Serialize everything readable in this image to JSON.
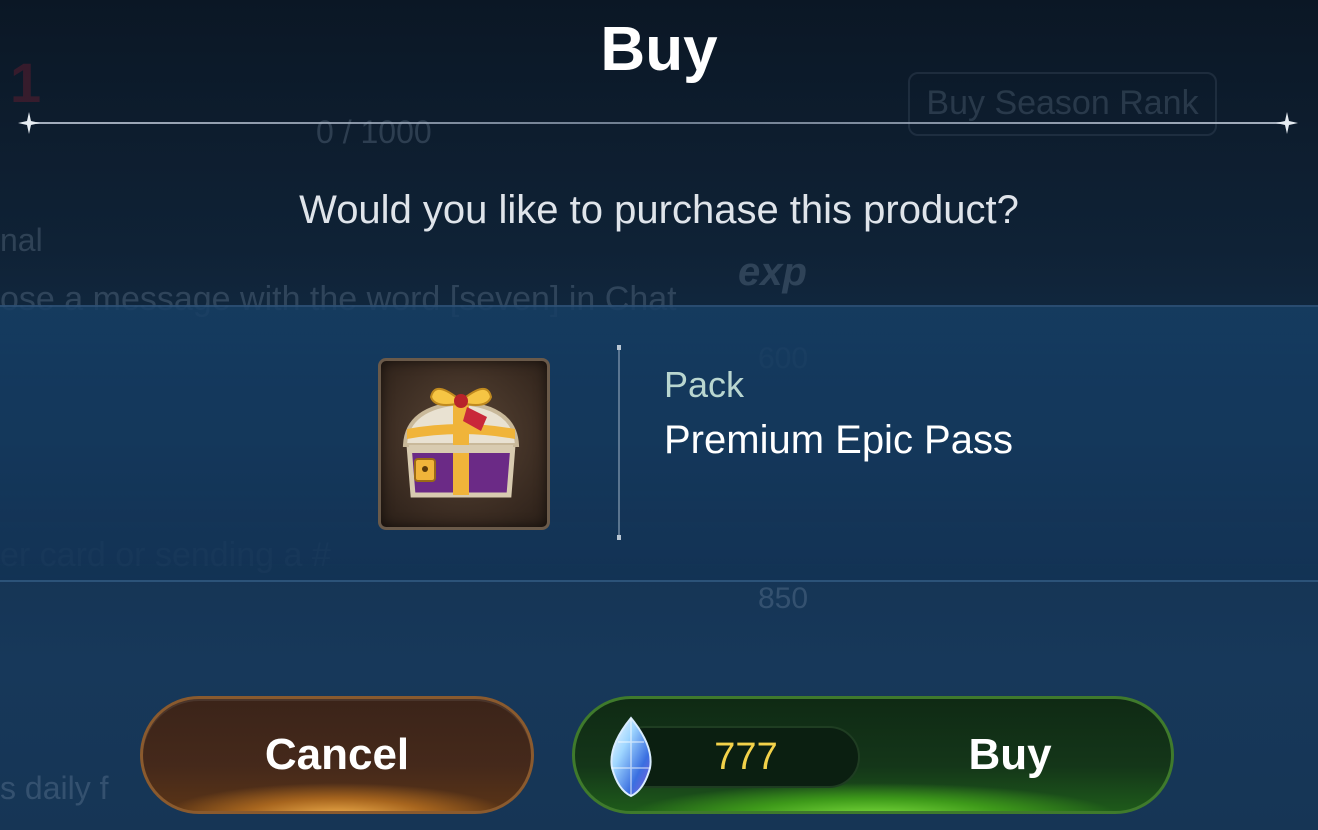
{
  "background": {
    "rank_button": "Buy Season Rank",
    "progress": "0 / 1000",
    "mission_label": "nal",
    "mission_text": "ose a message with the word [seven] in Chat",
    "exp_label": "exp",
    "exp_value_1": "600",
    "exp_value_2": "850",
    "mission_text_2": "er card or sending a #",
    "daily_text": "s daily f",
    "level_digit": "1"
  },
  "dialog": {
    "title": "Buy",
    "question": "Would you like to purchase this product?",
    "item": {
      "category": "Pack",
      "name": "Premium Epic Pass",
      "icon": "treasure-chest-icon"
    },
    "cancel_label": "Cancel",
    "buy_label": "Buy",
    "price": "777",
    "currency_icon": "crystal-gem-icon"
  },
  "colors": {
    "price": "#f3d24a",
    "buy_button": "#3e9a1a",
    "cancel_button": "#a7651e"
  }
}
